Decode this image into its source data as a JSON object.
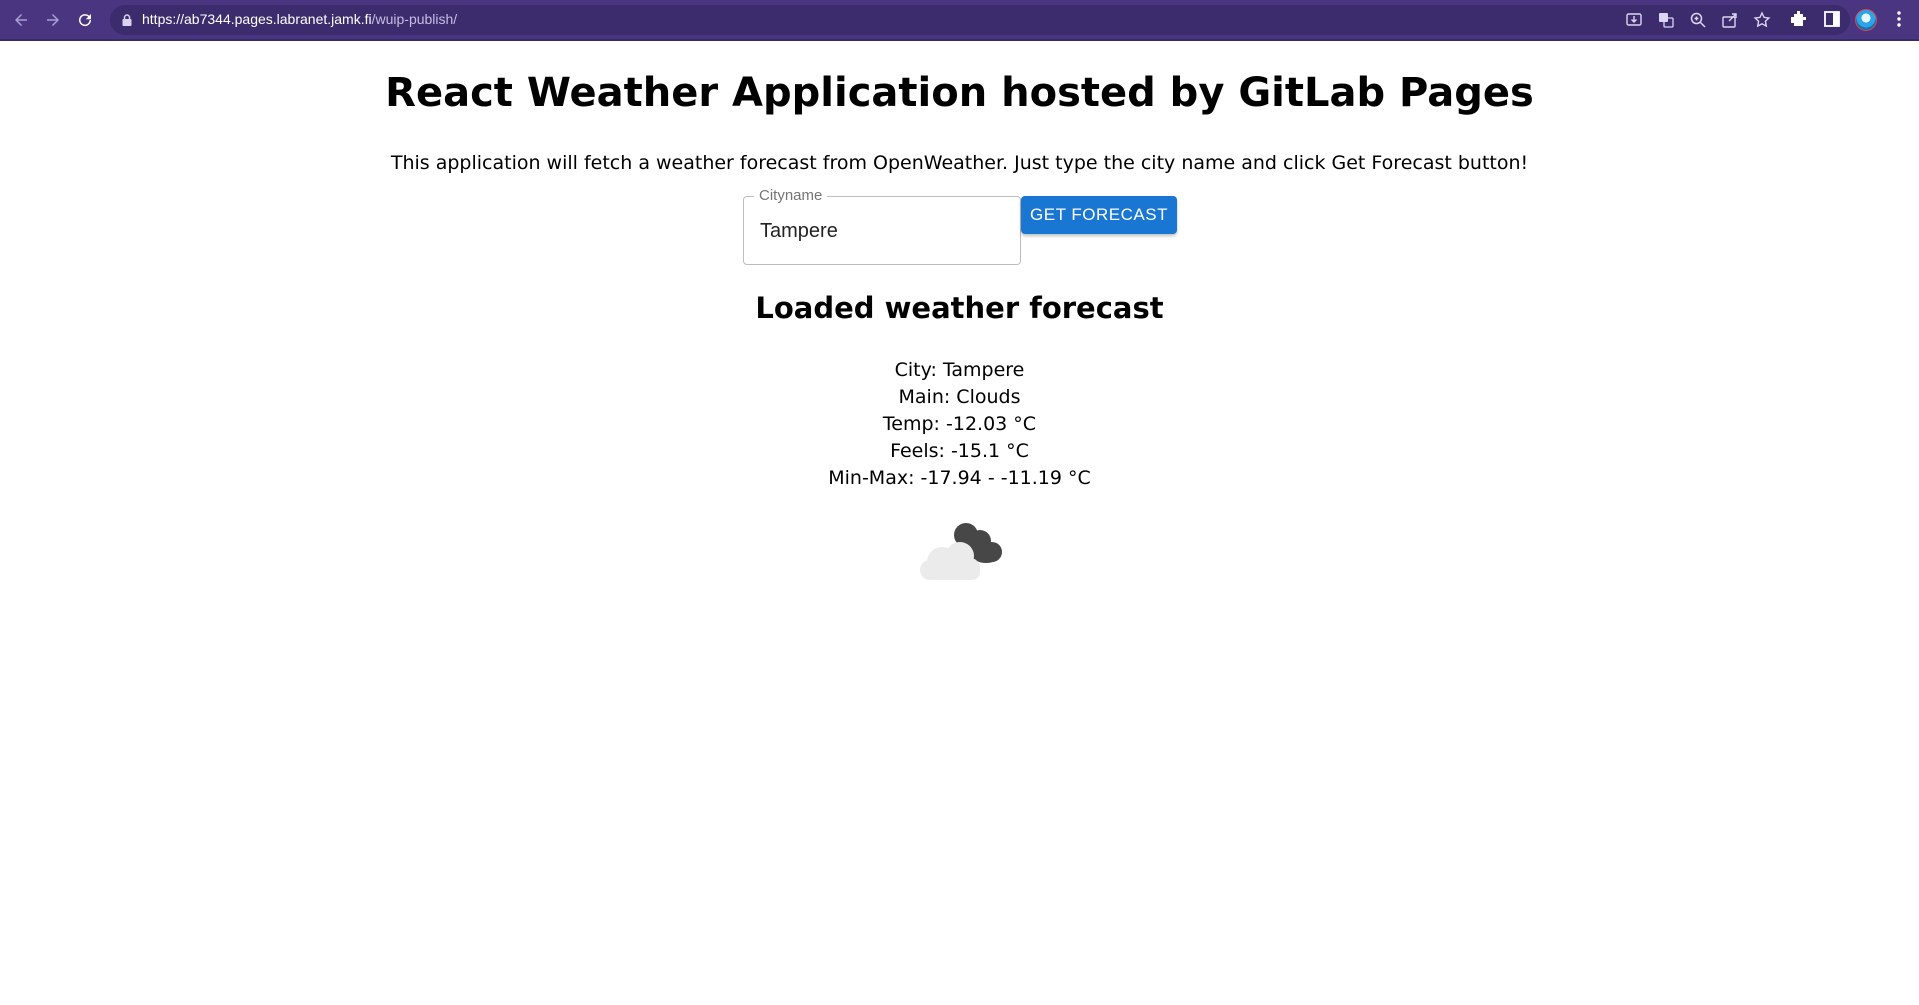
{
  "browser": {
    "url_host": "https://ab7344.pages.labranet.jamk.fi",
    "url_path": "/wuip-publish/",
    "back_icon": "arrow-left-icon",
    "forward_icon": "arrow-right-icon",
    "reload_icon": "reload-icon",
    "toolbar_color": "#4a3580"
  },
  "page": {
    "title": "React Weather Application hosted by GitLab Pages",
    "intro": "This application will fetch a weather forecast from OpenWeather. Just type the city name and click Get Forecast button!"
  },
  "form": {
    "city_label": "Cityname",
    "city_value": "Tampere",
    "button_label": "GET FORECAST",
    "button_color": "#1976d2"
  },
  "forecast": {
    "heading": "Loaded weather forecast",
    "city": "City: Tampere",
    "main": "Main: Clouds",
    "temp": "Temp: -12.03 °C",
    "feels": "Feels: -15.1 °C",
    "minmax": "Min-Max: -17.94 - -11.19 °C",
    "icon": "broken-clouds-icon"
  }
}
